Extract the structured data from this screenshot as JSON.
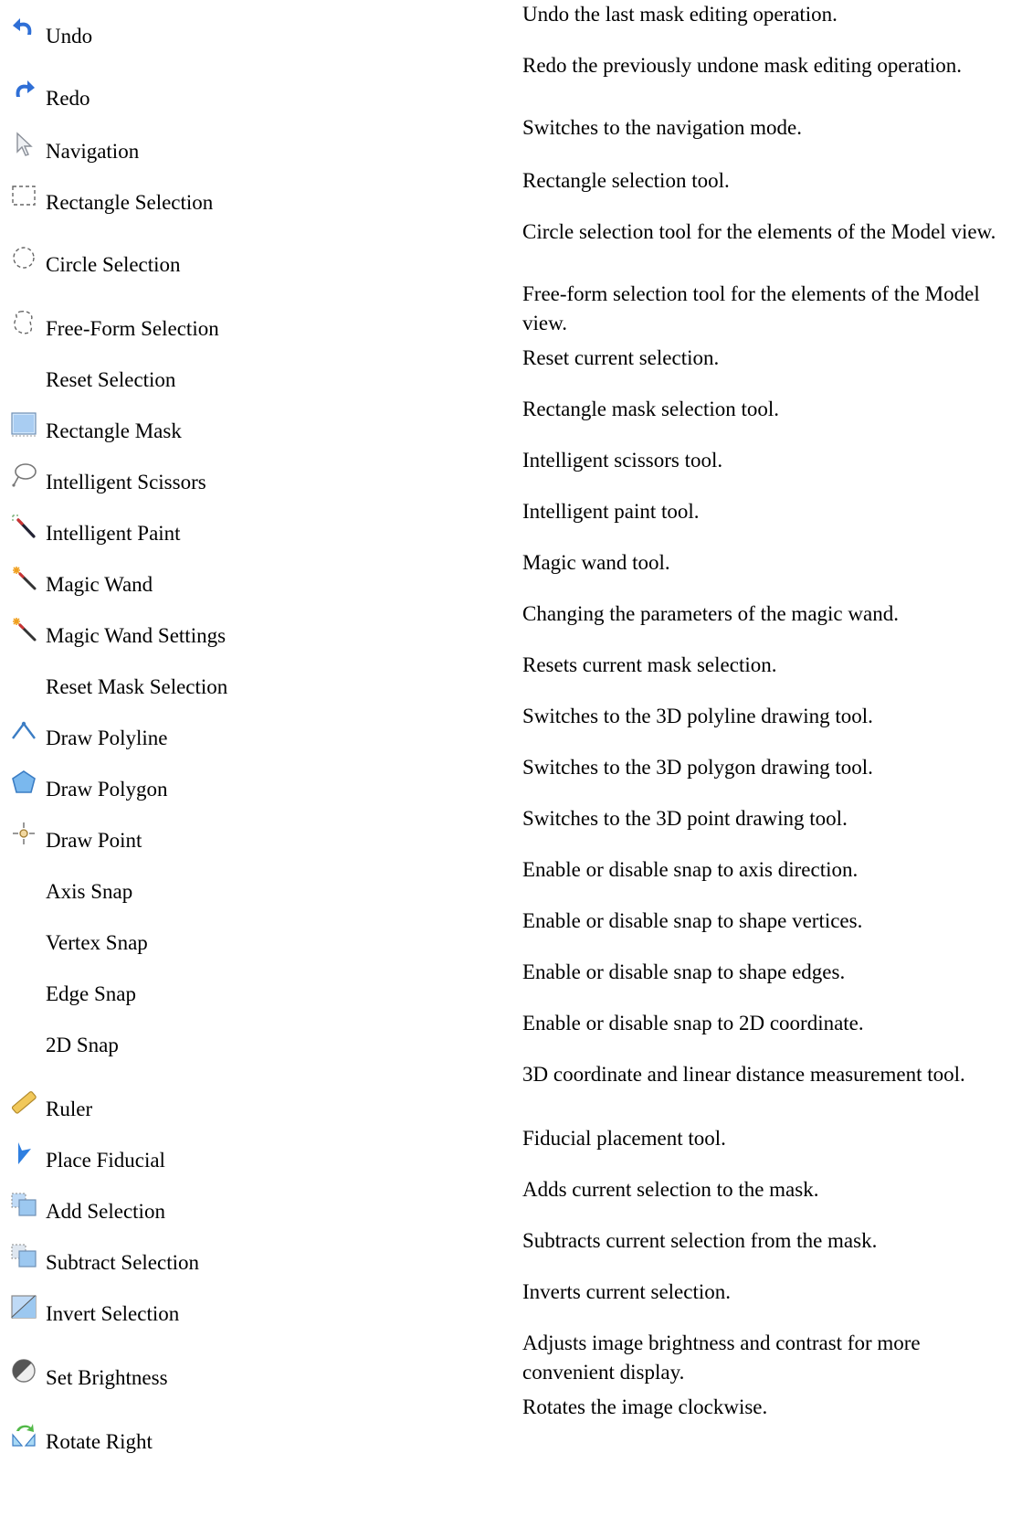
{
  "tools": [
    {
      "icon": "undo-icon",
      "name": "Undo",
      "desc": "Undo the last mask editing operation."
    },
    {
      "icon": "redo-icon",
      "name": "Redo",
      "desc": "Redo the previously undone mask editing operation."
    },
    {
      "icon": "navigation-arrow-icon",
      "name": "Navigation",
      "desc": "Switches to the navigation mode."
    },
    {
      "icon": "rectangle-selection-icon",
      "name": "Rectangle Selection",
      "desc": "Rectangle selection tool."
    },
    {
      "icon": "circle-selection-icon",
      "name": "Circle Selection",
      "desc": "Circle selection tool for the elements of the Model view."
    },
    {
      "icon": "free-form-selection-icon",
      "name": "Free-Form Selection",
      "desc": "Free-form selection tool for the elements of the Model view."
    },
    {
      "icon": "",
      "name": "Reset Selection",
      "desc": "Reset current selection."
    },
    {
      "icon": "rectangle-mask-icon",
      "name": "Rectangle Mask",
      "desc": "Rectangle mask selection tool."
    },
    {
      "icon": "intelligent-scissors-icon",
      "name": "Intelligent Scissors",
      "desc": "Intelligent scissors tool."
    },
    {
      "icon": "intelligent-paint-icon",
      "name": "Intelligent Paint",
      "desc": "Intelligent paint tool."
    },
    {
      "icon": "magic-wand-icon",
      "name": "Magic Wand",
      "desc": "Magic wand tool."
    },
    {
      "icon": "magic-wand-settings-icon",
      "name": "Magic Wand Settings",
      "desc": "Changing the parameters of the magic wand."
    },
    {
      "icon": "",
      "name": "Reset Mask Selection",
      "desc": "Resets current mask selection."
    },
    {
      "icon": "draw-polyline-icon",
      "name": "Draw Polyline",
      "desc": "Switches to the 3D polyline drawing tool."
    },
    {
      "icon": "draw-polygon-icon",
      "name": "Draw Polygon",
      "desc": "Switches to the 3D polygon drawing tool."
    },
    {
      "icon": "draw-point-icon",
      "name": "Draw Point",
      "desc": "Switches to the 3D point drawing tool."
    },
    {
      "icon": "",
      "name": "Axis Snap",
      "desc": "Enable or disable snap to axis direction."
    },
    {
      "icon": "",
      "name": "Vertex Snap",
      "desc": "Enable or disable snap to shape vertices."
    },
    {
      "icon": "",
      "name": "Edge Snap",
      "desc": "Enable or disable snap to shape edges."
    },
    {
      "icon": "",
      "name": "2D Snap",
      "desc": "Enable or disable snap to 2D coordinate."
    },
    {
      "icon": "ruler-icon",
      "name": "Ruler",
      "desc": "3D coordinate and linear distance measurement tool."
    },
    {
      "icon": "place-fiducial-icon",
      "name": "Place Fiducial",
      "desc": "Fiducial placement tool."
    },
    {
      "icon": "add-selection-icon",
      "name": "Add Selection",
      "desc": "Adds current selection to the mask."
    },
    {
      "icon": "subtract-selection-icon",
      "name": "Subtract Selection",
      "desc": "Subtracts current selection from the mask."
    },
    {
      "icon": "invert-selection-icon",
      "name": "Invert Selection",
      "desc": "Inverts current selection."
    },
    {
      "icon": "set-brightness-icon",
      "name": "Set Brightness",
      "desc": "Adjusts image brightness and contrast for more convenient display."
    },
    {
      "icon": "rotate-right-icon",
      "name": "Rotate Right",
      "desc": "Rotates the image clockwise."
    }
  ]
}
